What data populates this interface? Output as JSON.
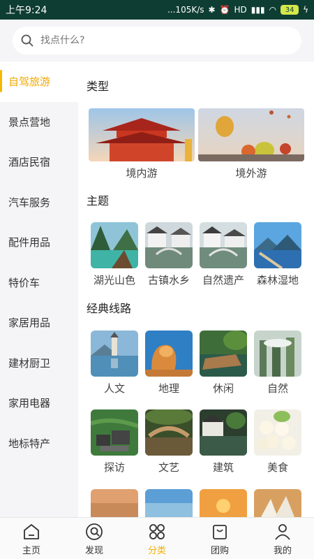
{
  "status_bar": {
    "time": "上午9:24",
    "speed": "...105K/s",
    "signal": "HD",
    "battery": "34"
  },
  "search": {
    "placeholder": "找点什么?"
  },
  "sidebar": {
    "items": [
      {
        "label": "自驾旅游",
        "active": true
      },
      {
        "label": "景点营地"
      },
      {
        "label": "酒店民宿"
      },
      {
        "label": "汽车服务"
      },
      {
        "label": "配件用品"
      },
      {
        "label": "特价车"
      },
      {
        "label": "家居用品"
      },
      {
        "label": "建材厨卫"
      },
      {
        "label": "家用电器"
      },
      {
        "label": "地标特产"
      }
    ]
  },
  "sections": {
    "type": {
      "title": "类型",
      "items": [
        {
          "label": "境内游"
        },
        {
          "label": "境外游"
        }
      ]
    },
    "theme": {
      "title": "主题",
      "items": [
        {
          "label": "湖光山色"
        },
        {
          "label": "古镇水乡"
        },
        {
          "label": "自然遗产"
        },
        {
          "label": "森林湿地"
        }
      ]
    },
    "routes": {
      "title": "经典线路",
      "items": [
        {
          "label": "人文"
        },
        {
          "label": "地理"
        },
        {
          "label": "休闲"
        },
        {
          "label": "自然"
        },
        {
          "label": "探访"
        },
        {
          "label": "文艺"
        },
        {
          "label": "建筑"
        },
        {
          "label": "美食"
        }
      ]
    }
  },
  "bottom_nav": {
    "items": [
      {
        "label": "主页",
        "icon": "home-icon"
      },
      {
        "label": "发现",
        "icon": "discover-icon"
      },
      {
        "label": "分类",
        "icon": "category-icon",
        "active": true
      },
      {
        "label": "团购",
        "icon": "group-buy-icon"
      },
      {
        "label": "我的",
        "icon": "profile-icon"
      }
    ]
  },
  "colors": {
    "accent": "#f0a800",
    "status_bar": "#0e3d33"
  }
}
